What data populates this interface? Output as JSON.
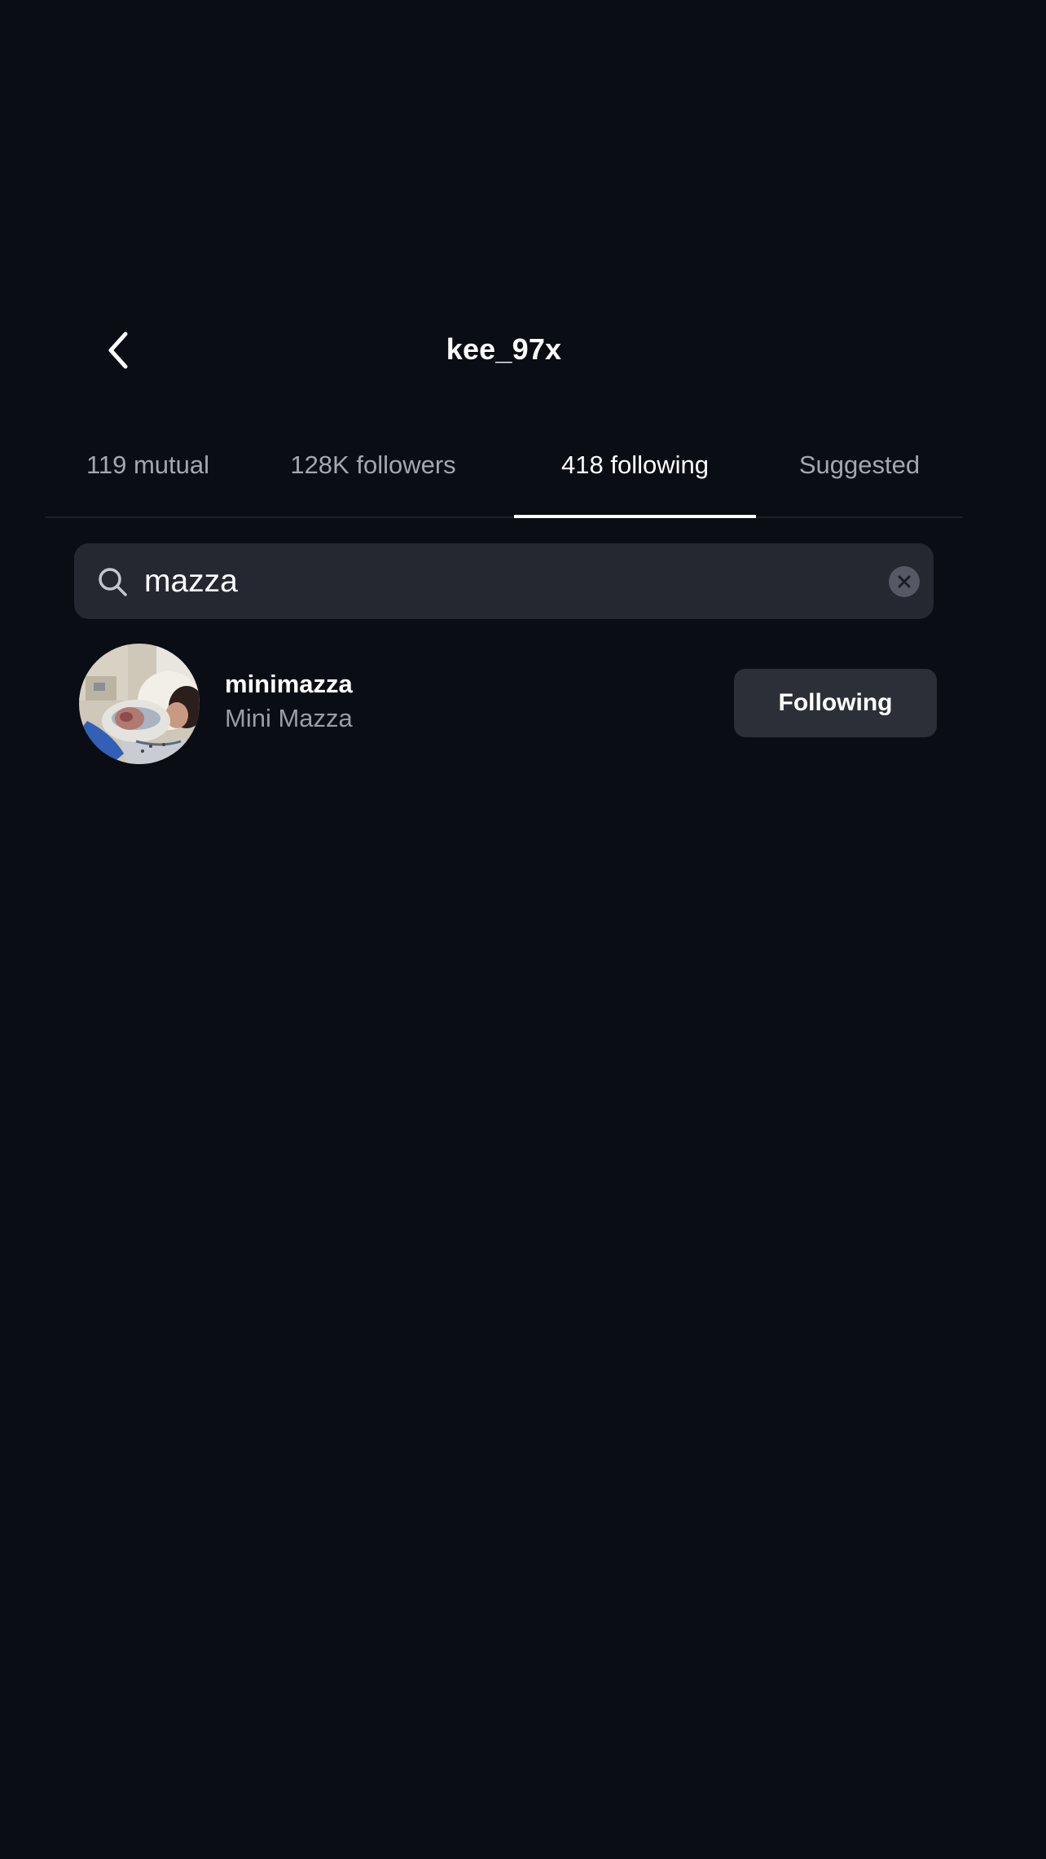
{
  "header": {
    "title": "kee_97x",
    "back_icon": "chevron-left-icon"
  },
  "tabs": [
    {
      "label": "119 mutual",
      "active": false
    },
    {
      "label": "128K followers",
      "active": false
    },
    {
      "label": "418 following",
      "active": true
    },
    {
      "label": "Suggested",
      "active": false
    }
  ],
  "search": {
    "value": "mazza",
    "icon": "search-icon",
    "clear_icon": "clear-icon"
  },
  "results": [
    {
      "username": "minimazza",
      "fullname": "Mini Mazza",
      "button_label": "Following",
      "avatar": "avatar"
    }
  ],
  "colors": {
    "background": "#0b0d14",
    "search_bg": "#252831",
    "button_bg": "#2c2f38",
    "inactive_tab": "#a4a7b0",
    "secondary_text": "#9a9da6"
  }
}
